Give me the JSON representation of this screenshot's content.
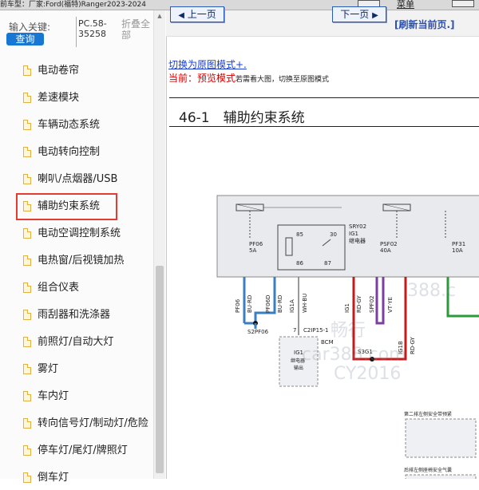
{
  "top": {
    "model": "前车型：厂家:Ford(福特)Ranger2023-2024",
    "menu": "菜单"
  },
  "search": {
    "label": "输入关键:",
    "button": "查询",
    "code": "PC.58-35258",
    "collapse": "折叠全部"
  },
  "nav": {
    "items": [
      {
        "label": "电动卷帘"
      },
      {
        "label": "差速模块"
      },
      {
        "label": "车辆动态系统"
      },
      {
        "label": "电动转向控制"
      },
      {
        "label": "喇叭/点烟器/USB"
      },
      {
        "label": "辅助约束系统",
        "selected": true
      },
      {
        "label": "电动空调控制系统"
      },
      {
        "label": "电热窗/后视镜加热"
      },
      {
        "label": "组合仪表"
      },
      {
        "label": "雨刮器和洗涤器"
      },
      {
        "label": "前照灯/自动大灯"
      },
      {
        "label": "雾灯"
      },
      {
        "label": "车内灯"
      },
      {
        "label": "转向信号灯/制动灯/危险"
      },
      {
        "label": "停车灯/尾灯/牌照灯"
      },
      {
        "label": "倒车灯"
      }
    ]
  },
  "viewer": {
    "prev": "上一页",
    "next": "下一页",
    "refresh": "[刷新当前页.]",
    "switch_link": "切换为原图模式+.",
    "current_prefix": "当前：预览模式",
    "current_suffix": "若需看大图，切换至原图模式",
    "section_title": "46-1　辅助约束系统"
  },
  "diagram": {
    "fuse_labels": [
      {
        "name": "PF06",
        "rating": "5A"
      },
      {
        "name": "PSF02",
        "rating": "40A"
      },
      {
        "name": "PF31",
        "rating": "10A"
      }
    ],
    "relay": {
      "name": "SRY02",
      "id": "IG1",
      "desc": "继电器",
      "pins": [
        "85",
        "30",
        "86",
        "87"
      ]
    },
    "wires": [
      "PF06",
      "BU·RD",
      "PF06D",
      "BU·RD",
      "IG1A",
      "WH·BU",
      "IG1",
      "RD·GY",
      "SPF02",
      "VT·YE",
      "IG1B",
      "RD·GY"
    ],
    "splices": [
      "S2PF06",
      "S3G1"
    ],
    "connector": "C2IP15-1",
    "connector_pin": "7",
    "bcm": "BCM",
    "bcm_box": {
      "id": "IG1",
      "line1": "继电器",
      "line2": "输出"
    },
    "right_label_1": "第二排左侧安全带预紧",
    "right_label_2": "后排左侧座椅安全气囊"
  },
  "watermark": [
    "畅行",
    "388.c",
    "car388.com",
    "CY2016"
  ],
  "colors": {
    "accent": "#1877d2",
    "highlight": "#e53b30",
    "wire_blue": "#3a7fc2",
    "wire_red": "#c41a1a",
    "wire_purple": "#7a3fa0",
    "wire_green": "#2a9a3a"
  }
}
